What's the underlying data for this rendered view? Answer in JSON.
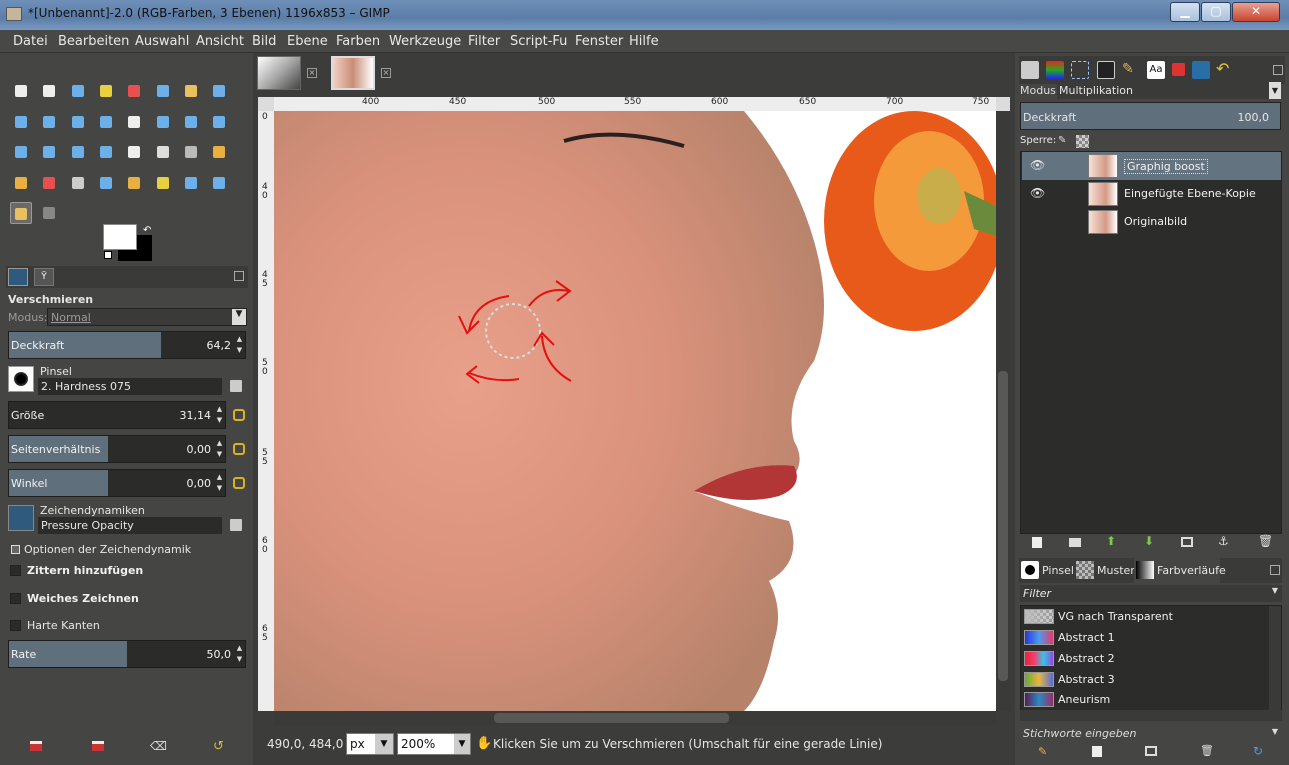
{
  "window": {
    "title": "*[Unbenannt]-2.0 (RGB-Farben, 3 Ebenen) 1196x853 – GIMP"
  },
  "menu": [
    "Datei",
    "Bearbeiten",
    "Auswahl",
    "Ansicht",
    "Bild",
    "Ebene",
    "Farben",
    "Werkzeuge",
    "Filter",
    "Script-Fu",
    "Fenster",
    "Hilfe"
  ],
  "tool_options": {
    "title": "Verschmieren",
    "mode_label": "Modus:",
    "mode_value": "Normal",
    "opacity_label": "Deckkraft",
    "opacity_value": "64,2",
    "opacity_fraction": 0.642,
    "brush_label": "Pinsel",
    "brush_value": "2. Hardness 075",
    "size_label": "Größe",
    "size_value": "31,14",
    "aspect_label": "Seitenverhältnis",
    "aspect_value": "0,00",
    "angle_label": "Winkel",
    "angle_value": "0,00",
    "dynamics_label": "Zeichendynamiken",
    "dynamics_value": "Pressure Opacity",
    "dyn_options": "Optionen der Zeichendynamik",
    "jitter": "Zittern hinzufügen",
    "smooth": "Weiches Zeichnen",
    "hard_edges": "Harte Kanten",
    "rate_label": "Rate",
    "rate_value": "50,0",
    "rate_fraction": 0.5
  },
  "ruler_top": [
    "400",
    "450",
    "500",
    "550",
    "600",
    "650",
    "700",
    "750"
  ],
  "ruler_left": [
    "0",
    "4 0",
    "4 5",
    "5 0",
    "5 5",
    "6 0",
    "6 5"
  ],
  "status": {
    "coords": "490,0, 484,0",
    "unit": "px",
    "zoom": "200",
    "zoom_suffix": "%",
    "message": "Klicken Sie um zu Verschmieren (Umschalt für eine gerade Linie)"
  },
  "layers_panel": {
    "mode_label": "Modus:",
    "mode_value": "Multiplikation",
    "opacity_label": "Deckkraft",
    "opacity_value": "100,0",
    "lock_label": "Sperre:",
    "layers": [
      "Graphig boost",
      "Eingefügte Ebene-Kopie",
      "Originalbild"
    ]
  },
  "resources_panel": {
    "tabs": [
      "Pinsel",
      "Muster",
      "Farbverläufe"
    ],
    "filter_label": "Filter",
    "gradients": [
      "VG nach Transparent",
      "Abstract 1",
      "Abstract 2",
      "Abstract 3",
      "Aneurism"
    ],
    "tag_placeholder": "Stichworte eingeben"
  }
}
